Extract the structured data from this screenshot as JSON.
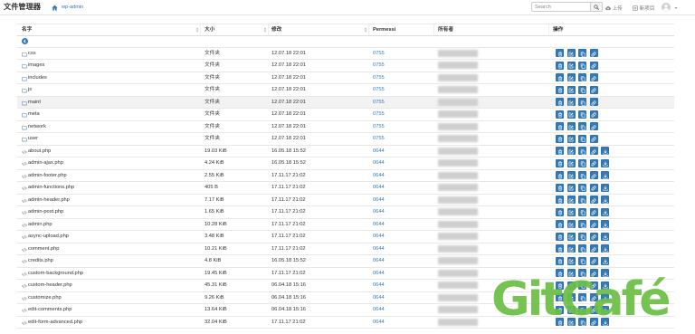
{
  "app": {
    "title": "文件管理器"
  },
  "breadcrumb": {
    "home_icon": "home-icon",
    "path": "wp-admin"
  },
  "toolbar": {
    "search_placeholder": "Search",
    "search_icon": "search-icon",
    "upload_icon": "cloud-upload-icon",
    "upload_label": "上传",
    "new_item_icon": "plus-square-icon",
    "new_item_label": "新项目",
    "avatar_icon": "user-avatar-icon",
    "menu_icon": "chevron-down-icon"
  },
  "table": {
    "sort_icon": "sort-icon",
    "back_icon": "back-arrow-icon",
    "headers": {
      "name": "名字",
      "size": "大小",
      "modified": "修改",
      "perms": "Permessi",
      "owner": "所有者",
      "actions": "操作"
    },
    "rows": [
      {
        "icon": "folder-icon",
        "name": "css",
        "size": "文件夹",
        "modified": "12.07.18 22:01",
        "perms": "0755"
      },
      {
        "icon": "folder-icon",
        "name": "images",
        "size": "文件夹",
        "modified": "12.07.18 22:01",
        "perms": "0755"
      },
      {
        "icon": "folder-icon",
        "name": "includes",
        "size": "文件夹",
        "modified": "12.07.18 22:01",
        "perms": "0755"
      },
      {
        "icon": "folder-icon",
        "name": "js",
        "size": "文件夹",
        "modified": "12.07.18 22:01",
        "perms": "0755"
      },
      {
        "icon": "folder-icon",
        "name": "maint",
        "size": "文件夹",
        "modified": "12.07.18 22:01",
        "perms": "0755",
        "highlighted": true
      },
      {
        "icon": "folder-icon",
        "name": "meta",
        "size": "文件夹",
        "modified": "12.07.18 22:01",
        "perms": "0755"
      },
      {
        "icon": "folder-icon",
        "name": "network",
        "size": "文件夹",
        "modified": "12.07.18 22:01",
        "perms": "0755"
      },
      {
        "icon": "folder-icon",
        "name": "user",
        "size": "文件夹",
        "modified": "12.07.18 22:01",
        "perms": "0755"
      },
      {
        "icon": "code-file-icon",
        "name": "about.php",
        "size": "19.03 KiB",
        "modified": "16.05.18 15:52",
        "perms": "0644"
      },
      {
        "icon": "code-file-icon",
        "name": "admin-ajax.php",
        "size": "4.24 KiB",
        "modified": "16.05.18 15:52",
        "perms": "0644"
      },
      {
        "icon": "code-file-icon",
        "name": "admin-footer.php",
        "size": "2.55 KiB",
        "modified": "17.11.17 21:02",
        "perms": "0644"
      },
      {
        "icon": "code-file-icon",
        "name": "admin-functions.php",
        "size": "405 B",
        "modified": "17.11.17 21:02",
        "perms": "0644"
      },
      {
        "icon": "code-file-icon",
        "name": "admin-header.php",
        "size": "7.17 KiB",
        "modified": "17.11.17 21:02",
        "perms": "0644"
      },
      {
        "icon": "code-file-icon",
        "name": "admin-post.php",
        "size": "1.65 KiB",
        "modified": "17.11.17 21:02",
        "perms": "0644"
      },
      {
        "icon": "code-file-icon",
        "name": "admin.php",
        "size": "10.28 KiB",
        "modified": "17.11.17 21:02",
        "perms": "0644"
      },
      {
        "icon": "code-file-icon",
        "name": "async-upload.php",
        "size": "3.48 KiB",
        "modified": "17.11.17 21:02",
        "perms": "0644"
      },
      {
        "icon": "code-file-icon",
        "name": "comment.php",
        "size": "10.21 KiB",
        "modified": "17.11.17 21:02",
        "perms": "0644"
      },
      {
        "icon": "code-file-icon",
        "name": "credits.php",
        "size": "4.8 KiB",
        "modified": "16.05.18 15:52",
        "perms": "0644"
      },
      {
        "icon": "code-file-icon",
        "name": "custom-background.php",
        "size": "19.45 KiB",
        "modified": "17.11.17 21:02",
        "perms": "0644"
      },
      {
        "icon": "code-file-icon",
        "name": "custom-header.php",
        "size": "45.31 KiB",
        "modified": "06.04.18 15:16",
        "perms": "0644"
      },
      {
        "icon": "code-file-icon",
        "name": "customize.php",
        "size": "9.26 KiB",
        "modified": "06.04.18 15:16",
        "perms": "0644"
      },
      {
        "icon": "code-file-icon",
        "name": "edit-comments.php",
        "size": "13.64 KiB",
        "modified": "06.04.18 15:16",
        "perms": "0644"
      },
      {
        "icon": "code-file-icon",
        "name": "edit-form-advanced.php",
        "size": "32.04 KiB",
        "modified": "17.11.17 21:02",
        "perms": "0644"
      }
    ]
  },
  "row_actions": {
    "folder-icon": [
      "trash-icon",
      "rename-icon",
      "copy-icon",
      "link-icon"
    ],
    "code-file-icon": [
      "trash-icon",
      "rename-icon",
      "copy-icon",
      "link-icon",
      "download-icon"
    ]
  },
  "watermark": {
    "text": "GitCafé"
  },
  "colors": {
    "accent": "#337ab7",
    "action_button": "#337ab7",
    "action_button_border": "#2e6da4",
    "watermark": "#6cbf47",
    "highlight_row": "#f2f2f2"
  }
}
